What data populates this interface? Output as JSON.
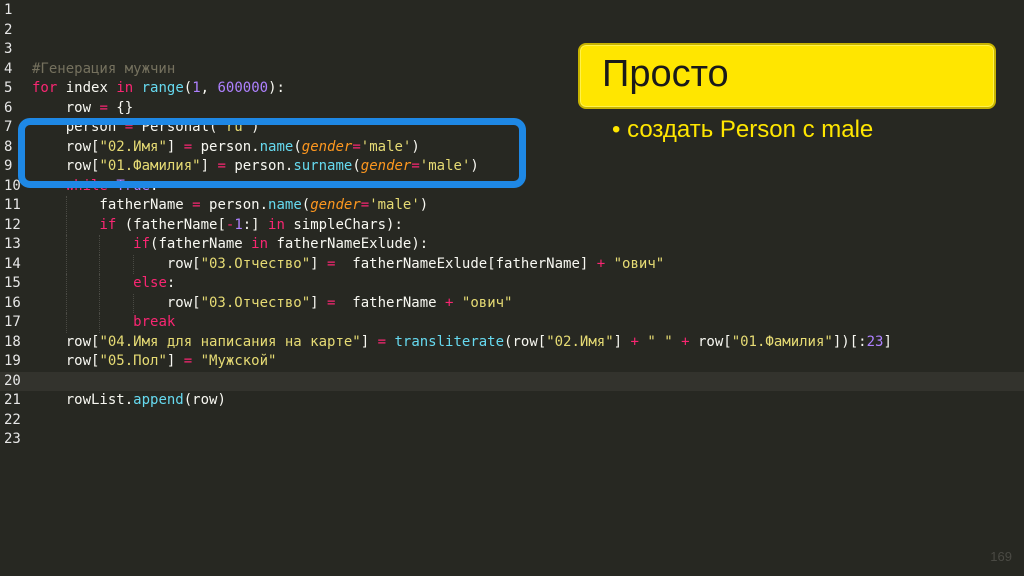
{
  "colors": {
    "background": "#272822",
    "highlight_box": "#1e88e5",
    "title_fill": "#ffe600",
    "keyword": "#f92672",
    "builtin": "#66d9ef",
    "number": "#ae81ff",
    "string": "#e6db74",
    "comment": "#75715e",
    "parameter": "#fd971f"
  },
  "slide": {
    "title": "Просто",
    "bullet": "• создать Person с male",
    "page_number": "169"
  },
  "code": {
    "current_line": 20,
    "lines": [
      {
        "n": "1",
        "tokens": []
      },
      {
        "n": "2",
        "tokens": []
      },
      {
        "n": "3",
        "tokens": []
      },
      {
        "n": "4",
        "tokens": [
          {
            "c": "t-cm",
            "t": "#Генерация мужчин"
          }
        ]
      },
      {
        "n": "5",
        "tokens": [
          {
            "c": "t-kw",
            "t": "for"
          },
          {
            "c": "t-var",
            "t": " index "
          },
          {
            "c": "t-kw",
            "t": "in"
          },
          {
            "c": "t-var",
            "t": " "
          },
          {
            "c": "t-bi",
            "t": "range"
          },
          {
            "c": "t-var",
            "t": "("
          },
          {
            "c": "t-num",
            "t": "1"
          },
          {
            "c": "t-var",
            "t": ", "
          },
          {
            "c": "t-num",
            "t": "600000"
          },
          {
            "c": "t-var",
            "t": "):"
          }
        ]
      },
      {
        "n": "6",
        "tokens": [
          {
            "c": "t-var",
            "t": "    row "
          },
          {
            "c": "t-op",
            "t": "="
          },
          {
            "c": "t-var",
            "t": " {}"
          }
        ]
      },
      {
        "n": "7",
        "tokens": [
          {
            "c": "t-var",
            "t": "    person "
          },
          {
            "c": "t-op",
            "t": "="
          },
          {
            "c": "t-var",
            "t": " Personal("
          },
          {
            "c": "t-str",
            "t": "'ru'"
          },
          {
            "c": "t-var",
            "t": ")"
          }
        ]
      },
      {
        "n": "8",
        "tokens": [
          {
            "c": "t-var",
            "t": "    row["
          },
          {
            "c": "t-str",
            "t": "\"02.Имя\""
          },
          {
            "c": "t-var",
            "t": "] "
          },
          {
            "c": "t-op",
            "t": "="
          },
          {
            "c": "t-var",
            "t": " person."
          },
          {
            "c": "t-bi",
            "t": "name"
          },
          {
            "c": "t-var",
            "t": "("
          },
          {
            "c": "t-param",
            "t": "gender"
          },
          {
            "c": "t-op",
            "t": "="
          },
          {
            "c": "t-str",
            "t": "'male'"
          },
          {
            "c": "t-var",
            "t": ")"
          }
        ]
      },
      {
        "n": "9",
        "tokens": [
          {
            "c": "t-var",
            "t": "    row["
          },
          {
            "c": "t-str",
            "t": "\"01.Фамилия\""
          },
          {
            "c": "t-var",
            "t": "] "
          },
          {
            "c": "t-op",
            "t": "="
          },
          {
            "c": "t-var",
            "t": " person."
          },
          {
            "c": "t-bi",
            "t": "surname"
          },
          {
            "c": "t-var",
            "t": "("
          },
          {
            "c": "t-param",
            "t": "gender"
          },
          {
            "c": "t-op",
            "t": "="
          },
          {
            "c": "t-str",
            "t": "'male'"
          },
          {
            "c": "t-var",
            "t": ")"
          }
        ]
      },
      {
        "n": "10",
        "tokens": [
          {
            "c": "t-var",
            "t": "    "
          },
          {
            "c": "t-kw",
            "t": "while"
          },
          {
            "c": "t-var",
            "t": " "
          },
          {
            "c": "t-num",
            "t": "True"
          },
          {
            "c": "t-var",
            "t": ":"
          }
        ]
      },
      {
        "n": "11",
        "tokens": [
          {
            "c": "t-var",
            "t": "        fatherName "
          },
          {
            "c": "t-op",
            "t": "="
          },
          {
            "c": "t-var",
            "t": " person."
          },
          {
            "c": "t-bi",
            "t": "name"
          },
          {
            "c": "t-var",
            "t": "("
          },
          {
            "c": "t-param",
            "t": "gender"
          },
          {
            "c": "t-op",
            "t": "="
          },
          {
            "c": "t-str",
            "t": "'male'"
          },
          {
            "c": "t-var",
            "t": ")"
          }
        ]
      },
      {
        "n": "12",
        "tokens": [
          {
            "c": "t-var",
            "t": "        "
          },
          {
            "c": "t-kw",
            "t": "if"
          },
          {
            "c": "t-var",
            "t": " (fatherName["
          },
          {
            "c": "t-op",
            "t": "-"
          },
          {
            "c": "t-num",
            "t": "1"
          },
          {
            "c": "t-var",
            "t": ":] "
          },
          {
            "c": "t-kw",
            "t": "in"
          },
          {
            "c": "t-var",
            "t": " simpleChars):"
          }
        ]
      },
      {
        "n": "13",
        "tokens": [
          {
            "c": "t-var",
            "t": "            "
          },
          {
            "c": "t-kw",
            "t": "if"
          },
          {
            "c": "t-var",
            "t": "(fatherName "
          },
          {
            "c": "t-kw",
            "t": "in"
          },
          {
            "c": "t-var",
            "t": " fatherNameExlude):"
          }
        ]
      },
      {
        "n": "14",
        "tokens": [
          {
            "c": "t-var",
            "t": "                row["
          },
          {
            "c": "t-str",
            "t": "\"03.Отчество\""
          },
          {
            "c": "t-var",
            "t": "] "
          },
          {
            "c": "t-op",
            "t": "="
          },
          {
            "c": "t-var",
            "t": "  fatherNameExlude[fatherName] "
          },
          {
            "c": "t-op",
            "t": "+"
          },
          {
            "c": "t-var",
            "t": " "
          },
          {
            "c": "t-str",
            "t": "\"ович\""
          }
        ]
      },
      {
        "n": "15",
        "tokens": [
          {
            "c": "t-var",
            "t": "            "
          },
          {
            "c": "t-kw",
            "t": "else"
          },
          {
            "c": "t-var",
            "t": ":"
          }
        ]
      },
      {
        "n": "16",
        "tokens": [
          {
            "c": "t-var",
            "t": "                row["
          },
          {
            "c": "t-str",
            "t": "\"03.Отчество\""
          },
          {
            "c": "t-var",
            "t": "] "
          },
          {
            "c": "t-op",
            "t": "="
          },
          {
            "c": "t-var",
            "t": "  fatherName "
          },
          {
            "c": "t-op",
            "t": "+"
          },
          {
            "c": "t-var",
            "t": " "
          },
          {
            "c": "t-str",
            "t": "\"ович\""
          }
        ]
      },
      {
        "n": "17",
        "tokens": [
          {
            "c": "t-var",
            "t": "            "
          },
          {
            "c": "t-kw",
            "t": "break"
          }
        ]
      },
      {
        "n": "18",
        "tokens": [
          {
            "c": "t-var",
            "t": "    row["
          },
          {
            "c": "t-str",
            "t": "\"04.Имя для написания на карте\""
          },
          {
            "c": "t-var",
            "t": "] "
          },
          {
            "c": "t-op",
            "t": "="
          },
          {
            "c": "t-var",
            "t": " "
          },
          {
            "c": "t-bi",
            "t": "transliterate"
          },
          {
            "c": "t-var",
            "t": "(row["
          },
          {
            "c": "t-str",
            "t": "\"02.Имя\""
          },
          {
            "c": "t-var",
            "t": "] "
          },
          {
            "c": "t-op",
            "t": "+"
          },
          {
            "c": "t-var",
            "t": " "
          },
          {
            "c": "t-str",
            "t": "\" \""
          },
          {
            "c": "t-var",
            "t": " "
          },
          {
            "c": "t-op",
            "t": "+"
          },
          {
            "c": "t-var",
            "t": " row["
          },
          {
            "c": "t-str",
            "t": "\"01.Фамилия\""
          },
          {
            "c": "t-var",
            "t": "])[:"
          },
          {
            "c": "t-num",
            "t": "23"
          },
          {
            "c": "t-var",
            "t": "]"
          }
        ]
      },
      {
        "n": "19",
        "tokens": [
          {
            "c": "t-var",
            "t": "    row["
          },
          {
            "c": "t-str",
            "t": "\"05.Пол\""
          },
          {
            "c": "t-var",
            "t": "] "
          },
          {
            "c": "t-op",
            "t": "="
          },
          {
            "c": "t-var",
            "t": " "
          },
          {
            "c": "t-str",
            "t": "\"Мужской\""
          }
        ]
      },
      {
        "n": "20",
        "tokens": []
      },
      {
        "n": "21",
        "tokens": [
          {
            "c": "t-var",
            "t": "    rowList."
          },
          {
            "c": "t-bi",
            "t": "append"
          },
          {
            "c": "t-var",
            "t": "(row)"
          }
        ]
      },
      {
        "n": "22",
        "tokens": []
      },
      {
        "n": "23",
        "tokens": []
      }
    ]
  }
}
